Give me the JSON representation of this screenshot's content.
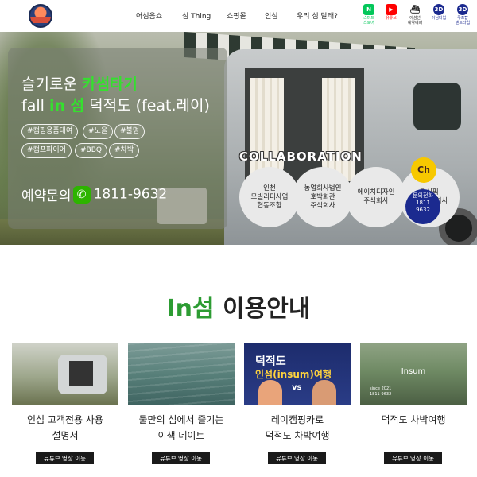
{
  "header": {
    "nav": [
      {
        "label": "어섬음쇼"
      },
      {
        "label": "섬 Thing"
      },
      {
        "label": "쇼핑몰"
      },
      {
        "label": "인섬"
      },
      {
        "label": "우리 섬 탈래?"
      }
    ],
    "quick_links": [
      {
        "label": "스마트\n스토어",
        "icon": "naver-store-icon",
        "color": "#03c75a"
      },
      {
        "label": "유튜브",
        "icon": "youtube-icon",
        "color": "#ff0000"
      },
      {
        "label": "어섬선\n예약예매",
        "icon": "boat-icon",
        "color": "#1a1a1a"
      },
      {
        "label": "어님타입",
        "icon": "3d-icon",
        "color": "#1b2a8f"
      },
      {
        "label": "루프탑\n렌트타입",
        "icon": "3d-icon",
        "color": "#1b2a8f"
      }
    ]
  },
  "hero": {
    "line1_prefix": "슬기로운 ",
    "line1_highlight": "카썸타기",
    "line2_prefix": "fall ",
    "line2_highlight": "in 섬",
    "line2_suffix": " 덕적도 (feat.레이)",
    "tags": [
      "#캠핑용품대여",
      "#노을",
      "#불멍",
      "#캠프파이어",
      "#BBQ",
      "#차박"
    ],
    "phone_prefix": "예약문의",
    "phone_number": "1811-9632",
    "collab_title": "COLLABORATION",
    "partners": [
      "인천\n모빌리티사업\n협동조합",
      "농업회사법인\n호박회관\n주식회사",
      "에이치디자인\n주식회사",
      "퍼시픽\n마린주식회사"
    ],
    "kakao_label": "Ch",
    "call_label": "문의전화\n1811\n9632"
  },
  "section": {
    "title_accent": "In섬",
    "title_rest": " 이용안내",
    "cards": [
      {
        "title": "인섬 고객전용 사용\n설명서",
        "button": "유튜브 영상 이동"
      },
      {
        "title": "둘만의 섬에서 즐기는\n이색 데이트",
        "button": "유튜브 영상 이동"
      },
      {
        "title": "레이캠핑카로\n덕적도 차박여행",
        "button": "유튜브 영상 이동"
      },
      {
        "title": "덕적도 차박여행",
        "button": "유튜브 영상 이동"
      }
    ],
    "thumb3": {
      "line1": "덕적도",
      "line2": "인섬(insum)여행",
      "vs": "vs"
    },
    "thumb4": {
      "label": "Insum",
      "sub": "since 2021\n1811-9632"
    }
  }
}
